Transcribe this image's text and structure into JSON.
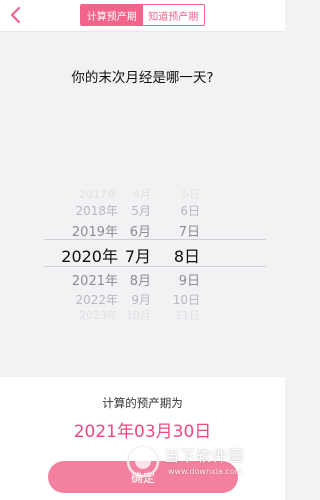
{
  "header": {
    "tabs": [
      {
        "label": "计算预产期",
        "active": true
      },
      {
        "label": "知道预产期",
        "active": false
      }
    ]
  },
  "question": "你的末次月经是哪一天?",
  "picker": {
    "rows": [
      {
        "year": "2017年",
        "month": "4月",
        "day": "5日"
      },
      {
        "year": "2018年",
        "month": "5月",
        "day": "6日"
      },
      {
        "year": "2019年",
        "month": "6月",
        "day": "7日"
      },
      {
        "year": "2020年",
        "month": "7月",
        "day": "8日",
        "selected": true
      },
      {
        "year": "2021年",
        "month": "8月",
        "day": "9日"
      },
      {
        "year": "2022年",
        "month": "9月",
        "day": "10日"
      },
      {
        "year": "2023年",
        "month": "10月",
        "day": "11日"
      }
    ]
  },
  "result": {
    "label": "计算的预产期为",
    "date": "2021年03月30日",
    "confirm_label": "确定"
  },
  "watermark": {
    "text": "当下软件园",
    "sub": "www.downxia.com"
  },
  "colors": {
    "accent": "#f2648a",
    "result_date": "#e94b7a",
    "button": "#f4809f"
  }
}
